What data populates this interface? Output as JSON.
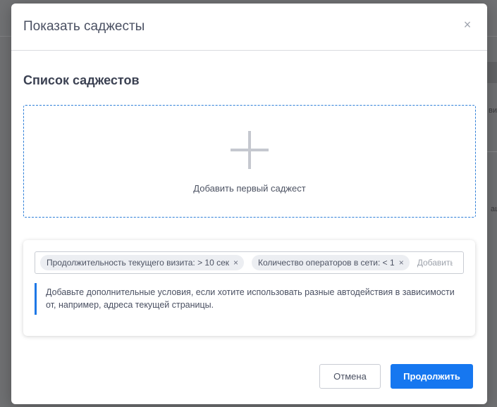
{
  "modal": {
    "title": "Показать саджесты",
    "close_icon": "close-icon"
  },
  "suggest_list": {
    "title": "Список саджестов",
    "add_first_label": "Добавить первый саджест",
    "add_icon": "plus-icon"
  },
  "conditions": {
    "tags": [
      {
        "label": "Продолжительность текущего визита: > 10 сек",
        "remove": "×"
      },
      {
        "label": "Количество операторов в сети: < 1",
        "remove": "×"
      }
    ],
    "add_placeholder": "Добавить",
    "hint": "Добавьте дополнительные условия, если хотите использовать разные автодействия в зависимости от, например, адреса текущей страницы."
  },
  "footer": {
    "cancel_label": "Отмена",
    "continue_label": "Продолжить"
  },
  "background": {
    "fragment_1": "вид",
    "fragment_2": "ац"
  },
  "colors": {
    "accent": "#1677f0",
    "dashed_border": "#2e7fd8",
    "overlay": "#6f7072"
  }
}
